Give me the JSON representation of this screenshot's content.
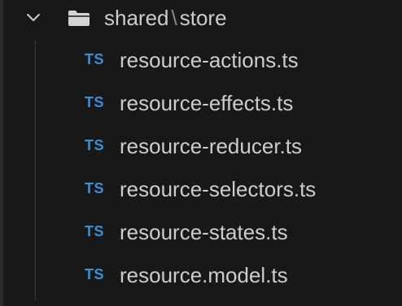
{
  "explorer": {
    "folder": {
      "name_part1": "shared",
      "separator": "\\",
      "name_part2": "store",
      "expanded": true,
      "chevron_icon": "chevron-down-icon",
      "folder_icon": "folder-open-icon"
    },
    "files": [
      {
        "badge": "TS",
        "name": "resource-actions.ts"
      },
      {
        "badge": "TS",
        "name": "resource-effects.ts"
      },
      {
        "badge": "TS",
        "name": "resource-reducer.ts"
      },
      {
        "badge": "TS",
        "name": "resource-selectors.ts"
      },
      {
        "badge": "TS",
        "name": "resource-states.ts"
      },
      {
        "badge": "TS",
        "name": "resource.model.ts"
      }
    ],
    "colors": {
      "background": "#181818",
      "text": "#cccccc",
      "ts_badge": "#3b8fd6"
    }
  }
}
